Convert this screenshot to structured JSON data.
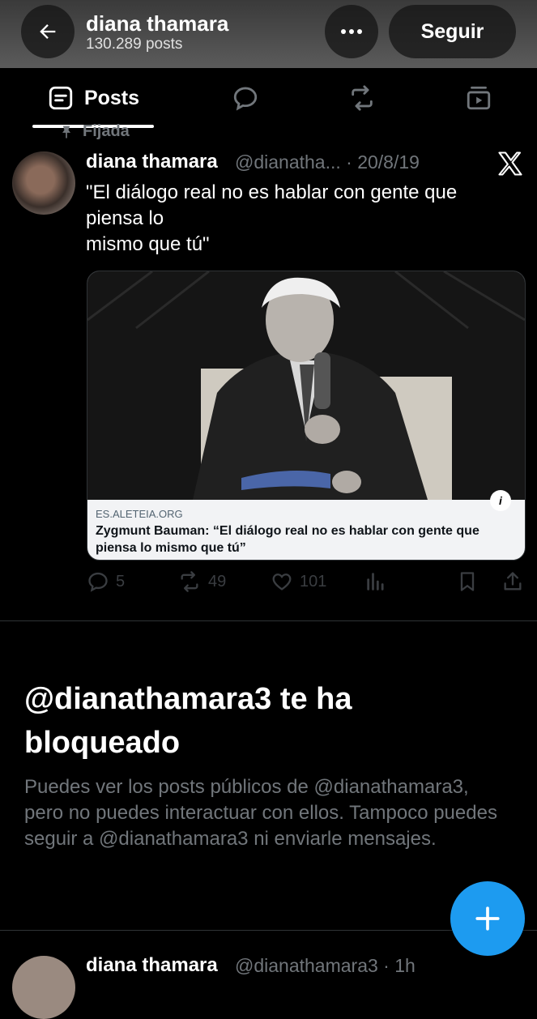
{
  "header": {
    "name": "diana thamara",
    "post_count": "130.289 posts",
    "follow_label": "Seguir"
  },
  "tabs": [
    {
      "label": "Posts",
      "active": true
    }
  ],
  "pinned_post": {
    "pinned_label": "Fijada",
    "author_name": "diana thamara",
    "handle_date": "@dianatha... · 20/8/19",
    "text_lines": [
      "\"El diálogo real no es hablar con gente que",
      "piensa lo",
      "mismo que tú\""
    ],
    "card": {
      "domain": "ES.ALETEIA.ORG",
      "title": "Zygmunt Bauman: “El diálogo real no es hablar con gente que piensa lo mismo que tú”"
    },
    "stats": {
      "replies": "5",
      "reposts": "49",
      "likes": "101"
    }
  },
  "blocked": {
    "title": "@dianathamara3 te ha bloqueado",
    "text": "Puedes ver los posts públicos de @dianathamara3, pero no puedes interactuar con ellos. Tampoco puedes seguir a @dianathamara3 ni enviarle mensajes."
  },
  "next_post": {
    "author_name": "diana thamara",
    "handle_date": "@dianathamara3 · 1h"
  },
  "colors": {
    "accent": "#1d9bf0",
    "background": "#000000",
    "muted": "#71767b"
  }
}
